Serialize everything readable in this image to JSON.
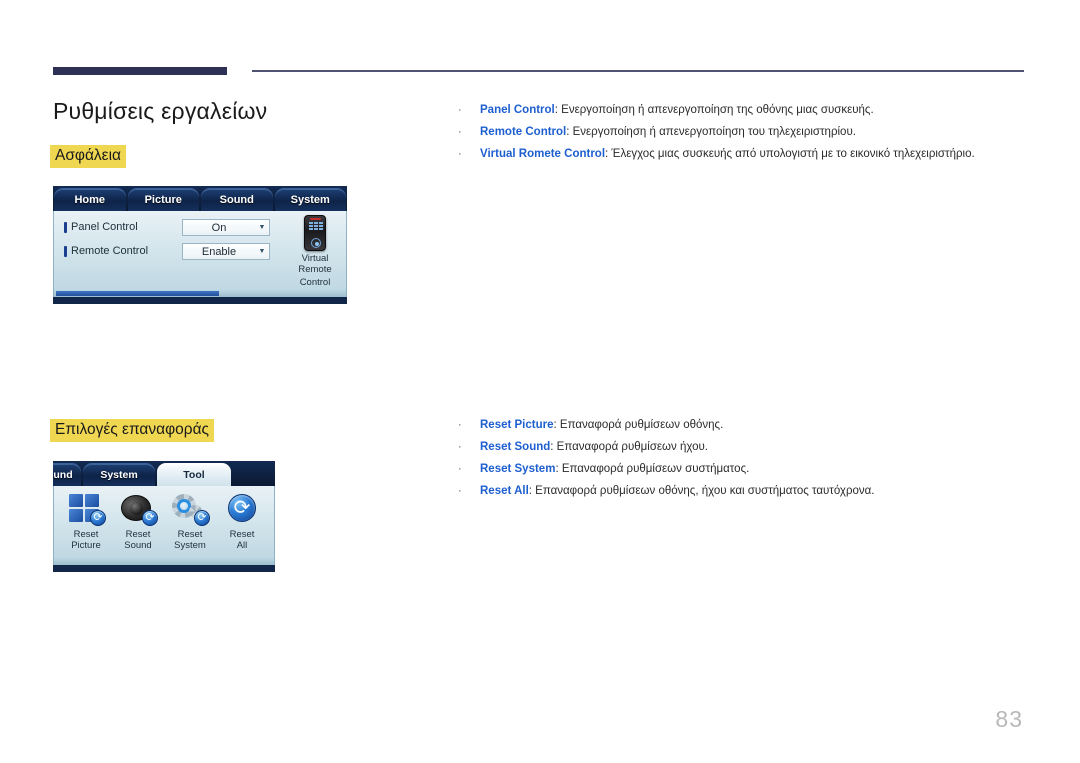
{
  "document": {
    "page_title": "Ρυθμίσεις εργαλείων",
    "page_number": "83"
  },
  "sections": [
    {
      "heading": "Ασφάλεια",
      "bullets": [
        {
          "term": "Panel Control",
          "desc": ": Ενεργοποίηση ή απενεργοποίηση της οθόνης μιας συσκευής."
        },
        {
          "term": "Remote Control",
          "desc": ": Ενεργοποίηση ή απενεργοποίηση του τηλεχειριστηρίου."
        },
        {
          "term": "Virtual Romete Control",
          "desc": ": Έλεγχος μιας συσκευής από υπολογιστή με το εικονικό τηλεχειριστήριο."
        }
      ]
    },
    {
      "heading": "Επιλογές επαναφοράς",
      "bullets": [
        {
          "term": "Reset Picture",
          "desc": ": Επαναφορά ρυθμίσεων οθόνης."
        },
        {
          "term": "Reset Sound",
          "desc": ": Επαναφορά ρυθμίσεων ήχου."
        },
        {
          "term": "Reset System",
          "desc": ": Επαναφορά ρυθμίσεων συστήματος."
        },
        {
          "term": "Reset All",
          "desc": ": Επαναφορά ρυθμίσεων οθόνης, ήχου και συστήματος ταυτόχρονα."
        }
      ]
    }
  ],
  "bullet_marker": "·",
  "screenshot_security": {
    "tabs": [
      "Home",
      "Picture",
      "Sound",
      "System"
    ],
    "settings": [
      {
        "label": "Panel Control",
        "value": "On"
      },
      {
        "label": "Remote Control",
        "value": "Enable"
      }
    ],
    "caret": "▼",
    "virtual_remote_line1": "Virtual Remote",
    "virtual_remote_line2": "Control"
  },
  "screenshot_reset": {
    "tabs": [
      {
        "label": "und",
        "active": false
      },
      {
        "label": "System",
        "active": false
      },
      {
        "label": "Tool",
        "active": true
      }
    ],
    "items": [
      {
        "line1": "Reset",
        "line2": "Picture"
      },
      {
        "line1": "Reset",
        "line2": "Sound"
      },
      {
        "line1": "Reset",
        "line2": "System"
      },
      {
        "line1": "Reset",
        "line2": "All"
      }
    ],
    "refresh_glyph": "⟳"
  },
  "colors": {
    "rule_dark": "#2e3054",
    "highlight_yellow": "#f0d752",
    "term_blue": "#1e5fd0",
    "page_number_gray": "#b9b9b9"
  }
}
